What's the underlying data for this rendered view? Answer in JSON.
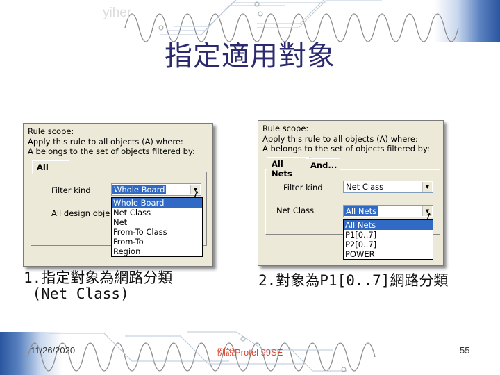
{
  "header": {
    "watermark": "yiher",
    "title": "指定適用對象"
  },
  "dialog_left": {
    "scope_lines": [
      "Rule scope:",
      "Apply this rule to all objects (A) where:",
      "A belongs to the set of objects filtered by:"
    ],
    "tab_label": "All",
    "filter_kind_label": "Filter kind",
    "filter_kind_value": "Whole Board",
    "hidden_label": "All design obje",
    "dropdown_options": [
      "Whole Board",
      "Net Class",
      "Net",
      "From-To Class",
      "From-To",
      "Region"
    ],
    "selected_option": "Whole Board"
  },
  "dialog_right": {
    "scope_lines": [
      "Rule scope:",
      "Apply this rule to all objects (A) where:",
      "A belongs to the set of objects filtered by:"
    ],
    "tabs": [
      "All Nets",
      "And..."
    ],
    "filter_kind_label": "Filter kind",
    "filter_kind_value": "Net Class",
    "net_class_label": "Net Class",
    "net_class_value": "All Nets",
    "dropdown_options": [
      "All Nets",
      "P1[0..7]",
      "P2[0..7]",
      "POWER"
    ],
    "selected_option": "All Nets"
  },
  "captions": {
    "left_line1": "1.指定對象為網路分類",
    "left_line2": " (Net Class)",
    "right": "2.對象為P1[0..7]網路分類"
  },
  "footer": {
    "date": "11/26/2020",
    "center": "例說Protel 99SE",
    "page": "55"
  },
  "colors": {
    "title": "#2b2a6e",
    "footer_center": "#d9462f",
    "selection": "#316ac5",
    "dialog_bg": "#ece9d8"
  }
}
